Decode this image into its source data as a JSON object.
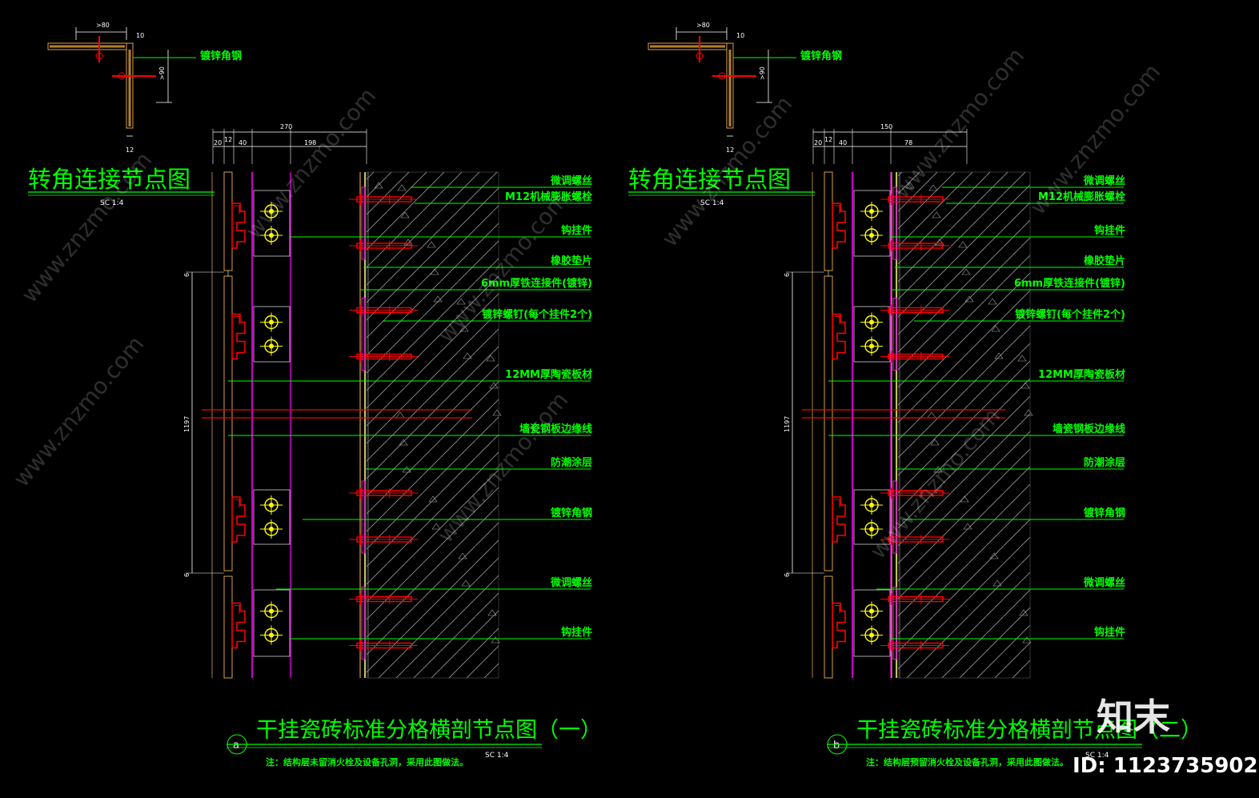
{
  "colors": {
    "background": "#000000",
    "label": "#00ff00",
    "anchor": "#ff0000",
    "bolt": "#ffff00",
    "keel": "#ff00ff",
    "dimension": "#ffffff"
  },
  "corner_detail": {
    "title": "转角连接节点图",
    "scale": "SC   1:4",
    "label": "镀锌角钢",
    "dims": {
      "top": ">80",
      "thick": "10",
      "side": ">90",
      "bottom": "12"
    }
  },
  "panels": [
    {
      "id": "a",
      "marker": "a",
      "title": "干挂瓷砖标准分格横剖节点图（一）",
      "note": "注：结构层未留消火栓及设备孔洞，采用此图做法。",
      "scale": "SC   1:4",
      "dims": {
        "total": "270",
        "d20": "20",
        "d12": "12",
        "d40": "40",
        "rest": "198",
        "height": "1197",
        "gap_top": "6",
        "gap_bottom": "6"
      },
      "labels": [
        "微调螺丝",
        "M12机械膨胀螺栓",
        "钩挂件",
        "橡胶垫片",
        "6mm厚铁连接件(镀锌)",
        "镀锌螺钉(每个挂件2个)",
        "12MM厚陶瓷板材",
        "墙瓷钢板边缘线",
        "防潮涂层",
        "镀锌角钢",
        "微调螺丝",
        "钩挂件"
      ]
    },
    {
      "id": "b",
      "marker": "b",
      "title": "干挂瓷砖标准分格横剖节点图（二）",
      "note": "注：结构层预留消火栓及设备孔洞，采用此图做法。",
      "scale": "SC   1:4",
      "dims": {
        "total": "150",
        "d20": "20",
        "d12": "12",
        "d40": "40",
        "rest": "78",
        "height": "1197",
        "gap_top": "6",
        "gap_bottom": "6"
      },
      "labels": [
        "微调螺丝",
        "M12机械膨胀螺栓",
        "钩挂件",
        "橡胶垫片",
        "6mm厚铁连接件(镀锌)",
        "镀锌螺钉(每个挂件2个)",
        "12MM厚陶瓷板材",
        "墙瓷钢板边缘线",
        "防潮涂层",
        "镀锌角钢",
        "微调螺丝",
        "钩挂件"
      ]
    }
  ],
  "watermark": {
    "site": "www.znzmo.com",
    "brand": "知末",
    "id_text": "ID: 1123735902"
  }
}
